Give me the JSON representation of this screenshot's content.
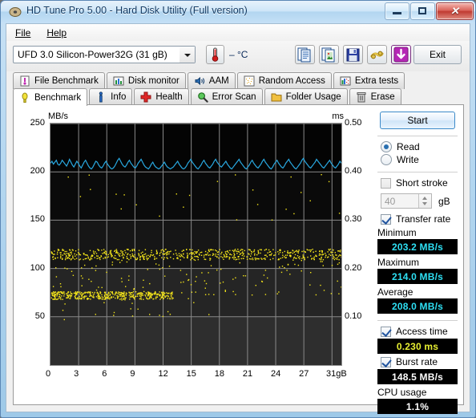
{
  "window": {
    "title": "HD Tune Pro 5.00 - Hard Disk Utility (Full version)",
    "minimize_label": "–",
    "maximize_label": "□",
    "close_label": "✕"
  },
  "menu": {
    "items": [
      "File",
      "Help"
    ]
  },
  "toolbar": {
    "drive_selected": "UFD 3.0 Silicon-Power32G (31 gB)",
    "temperature": "– °C",
    "exit_label": "Exit",
    "buttons": [
      "copy-text-icon",
      "copy-image-icon",
      "save-icon",
      "settings-icon",
      "download-icon"
    ]
  },
  "tabs": {
    "row1": [
      {
        "label": "File Benchmark",
        "icon": "file-benchmark-icon",
        "active": false
      },
      {
        "label": "Disk monitor",
        "icon": "disk-monitor-icon",
        "active": false
      },
      {
        "label": "AAM",
        "icon": "speaker-icon",
        "active": false
      },
      {
        "label": "Random Access",
        "icon": "random-access-icon",
        "active": false
      },
      {
        "label": "Extra tests",
        "icon": "extra-tests-icon",
        "active": false
      }
    ],
    "row2": [
      {
        "label": "Benchmark",
        "icon": "benchmark-icon",
        "active": true
      },
      {
        "label": "Info",
        "icon": "info-icon",
        "active": false
      },
      {
        "label": "Health",
        "icon": "health-icon",
        "active": false
      },
      {
        "label": "Error Scan",
        "icon": "error-scan-icon",
        "active": false
      },
      {
        "label": "Folder Usage",
        "icon": "folder-icon",
        "active": false
      },
      {
        "label": "Erase",
        "icon": "trash-icon",
        "active": false
      }
    ]
  },
  "controls": {
    "start_label": "Start",
    "read_label": "Read",
    "write_label": "Write",
    "read_checked": true,
    "write_checked": false,
    "short_stroke_label": "Short stroke",
    "short_stroke_checked": false,
    "short_stroke_value": "40",
    "short_stroke_unit": "gB",
    "transfer_rate_label": "Transfer rate",
    "transfer_rate_checked": true,
    "access_time_label": "Access time",
    "access_time_checked": true,
    "burst_rate_label": "Burst rate",
    "burst_rate_checked": true
  },
  "results": {
    "minimum_label": "Minimum",
    "minimum_value": "203.2 MB/s",
    "maximum_label": "Maximum",
    "maximum_value": "214.0 MB/s",
    "average_label": "Average",
    "average_value": "208.0 MB/s",
    "access_time_value": "0.230 ms",
    "burst_rate_value": "148.5 MB/s",
    "cpu_usage_label": "CPU usage",
    "cpu_usage_value": "1.1%"
  },
  "chart_data": {
    "type": "line",
    "title": "",
    "ylabel": "MB/s",
    "ylabel_right": "ms",
    "xlabel": "gB",
    "ylim": [
      0,
      250
    ],
    "ylim_right": [
      0,
      0.5
    ],
    "xlim": [
      0,
      31
    ],
    "yticks": [
      50,
      100,
      150,
      200,
      250
    ],
    "yticks_right": [
      0.1,
      0.2,
      0.3,
      0.4,
      0.5
    ],
    "xticks": [
      "0",
      "3",
      "6",
      "9",
      "12",
      "15",
      "18",
      "21",
      "24",
      "27",
      "31gB"
    ],
    "grid": true,
    "legend_position": "none",
    "colors": {
      "transfer_rate": "#29a8e0",
      "access_time": "#f5e61a",
      "background": "#050505"
    },
    "series": [
      {
        "name": "Transfer rate",
        "type": "line",
        "color": "#29a8e0",
        "axis": "left",
        "unit": "MB/s",
        "min": 203.2,
        "max": 214.0,
        "avg": 208.0,
        "values": [
          209,
          211,
          208,
          210,
          212,
          208,
          207,
          209,
          212,
          210,
          208,
          206,
          209,
          213,
          210,
          207,
          205,
          208,
          211,
          209,
          206,
          204,
          207,
          210,
          212,
          209,
          206,
          204,
          203,
          205,
          208,
          211,
          210,
          207,
          205,
          204,
          206,
          209,
          211,
          208,
          206,
          204,
          203,
          204,
          206,
          209,
          212,
          214,
          211,
          208,
          206,
          205,
          207,
          210,
          212,
          209,
          207,
          205,
          204,
          206,
          209,
          211,
          213,
          210,
          207,
          205,
          204,
          203,
          205,
          208,
          210,
          207,
          205,
          204,
          203,
          204,
          206,
          208,
          210,
          207,
          205,
          204,
          203,
          204,
          205,
          207,
          209,
          211,
          208,
          206,
          204,
          203,
          204,
          206,
          209,
          211,
          213,
          210,
          208,
          206,
          204,
          203,
          205,
          207,
          210,
          212,
          209,
          207,
          205,
          204,
          206,
          208,
          211,
          213,
          210,
          208,
          206,
          205,
          207,
          209,
          211,
          208,
          206,
          204,
          203,
          205,
          207,
          209,
          211,
          213,
          210,
          208,
          206,
          204,
          203,
          205,
          207,
          210,
          212,
          209,
          207,
          205,
          204,
          206,
          208,
          211,
          213,
          210,
          208,
          206,
          204,
          203,
          205,
          208,
          210,
          212,
          209,
          207,
          205,
          204,
          206,
          209,
          211,
          213,
          210,
          208,
          206,
          204,
          203,
          205,
          207,
          209,
          212,
          214,
          211,
          209,
          207,
          205,
          204,
          206,
          208,
          210,
          213,
          211,
          209,
          207,
          205,
          204,
          206,
          208,
          210,
          212,
          209,
          207,
          205,
          204,
          206,
          208,
          211,
          209
        ]
      },
      {
        "name": "Access time",
        "type": "scatter",
        "color": "#f5e61a",
        "axis": "right",
        "unit": "ms",
        "result": 0.23,
        "cluster_primary_ms": 0.23,
        "cluster_secondary_ms": 0.145,
        "note": "dense scatter band near 0.23 ms across full span; secondary dense band near 0.145 ms in first 40% of span; sparse outliers between 0.07 and 0.40 ms"
      }
    ]
  }
}
